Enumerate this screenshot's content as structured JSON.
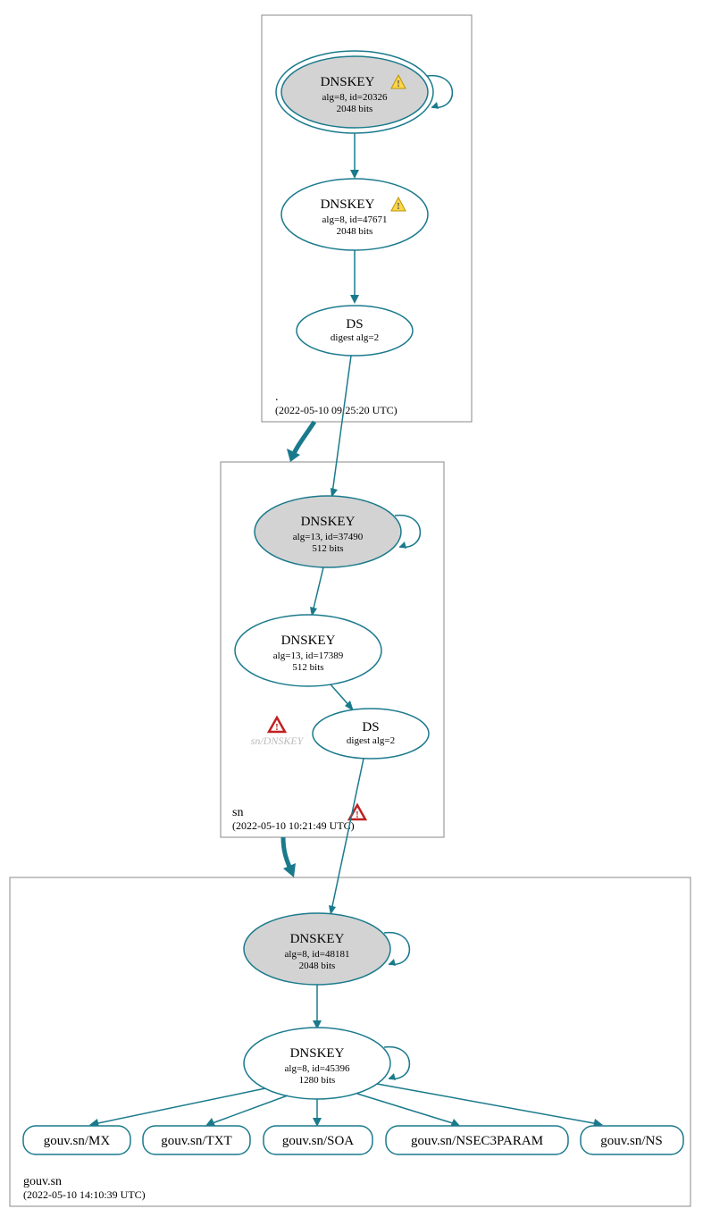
{
  "zones": {
    "root": {
      "label": ".",
      "date": "(2022-05-10 09:25:20 UTC)",
      "dnskey_ksk": {
        "title": "DNSKEY",
        "alg": "alg=8, id=20326",
        "bits": "2048 bits",
        "warn": true
      },
      "dnskey_zsk": {
        "title": "DNSKEY",
        "alg": "alg=8, id=47671",
        "bits": "2048 bits",
        "warn": true
      },
      "ds": {
        "title": "DS",
        "sub": "digest alg=2"
      }
    },
    "sn": {
      "label": "sn",
      "date": "(2022-05-10 10:21:49 UTC)",
      "dnskey_ksk": {
        "title": "DNSKEY",
        "alg": "alg=13, id=37490",
        "bits": "512 bits"
      },
      "dnskey_zsk": {
        "title": "DNSKEY",
        "alg": "alg=13, id=17389",
        "bits": "512 bits"
      },
      "ds": {
        "title": "DS",
        "sub": "digest alg=2"
      },
      "ghost": "sn/DNSKEY"
    },
    "gouv": {
      "label": "gouv.sn",
      "date": "(2022-05-10 14:10:39 UTC)",
      "dnskey_ksk": {
        "title": "DNSKEY",
        "alg": "alg=8, id=48181",
        "bits": "2048 bits"
      },
      "dnskey_zsk": {
        "title": "DNSKEY",
        "alg": "alg=8, id=45396",
        "bits": "1280 bits"
      }
    }
  },
  "records": {
    "mx": "gouv.sn/MX",
    "txt": "gouv.sn/TXT",
    "soa": "gouv.sn/SOA",
    "nsec3": "gouv.sn/NSEC3PARAM",
    "ns": "gouv.sn/NS"
  }
}
